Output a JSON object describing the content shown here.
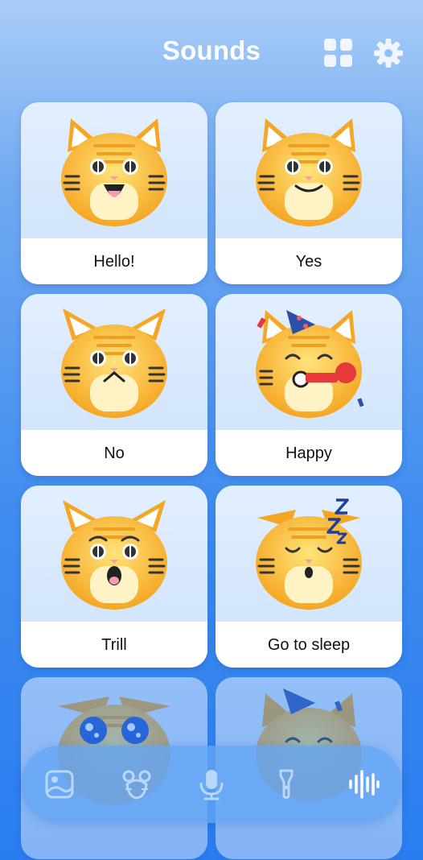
{
  "header": {
    "title": "Sounds",
    "grid_icon": "grid-icon",
    "settings_icon": "gear-icon"
  },
  "cards": [
    {
      "label": "Hello!",
      "mood": "hello"
    },
    {
      "label": "Yes",
      "mood": "yes"
    },
    {
      "label": "No",
      "mood": "no"
    },
    {
      "label": "Happy",
      "mood": "happy"
    },
    {
      "label": "Trill",
      "mood": "trill"
    },
    {
      "label": "Go to sleep",
      "mood": "sleep"
    },
    {
      "label": "",
      "mood": "sad"
    },
    {
      "label": "",
      "mood": "party"
    }
  ],
  "nav": {
    "items": [
      {
        "icon": "photo-icon"
      },
      {
        "icon": "mouse-icon"
      },
      {
        "icon": "microphone-icon"
      },
      {
        "icon": "flashlight-icon"
      },
      {
        "icon": "soundwave-icon",
        "active": true
      }
    ]
  },
  "colors": {
    "accent": "#2a7df0",
    "cat_orange": "#f5a623",
    "cat_light": "#ffd35a"
  }
}
